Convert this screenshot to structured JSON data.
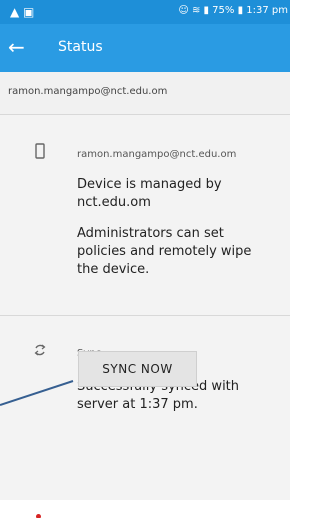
{
  "statusbar": {
    "left": "▲ ▣",
    "right": "☺ ≋ ▮ 75% ▮ 1:37 pm"
  },
  "toolbar": {
    "title": "Status",
    "back_icon": "arrow-left"
  },
  "account": {
    "header_email": "ramon.mangampo@nct.edu.om"
  },
  "device": {
    "email": "ramon.mangampo@nct.edu.om",
    "managed_text": "Device is managed by nct.edu.om",
    "admin_text": "Administrators can set policies and remotely wipe the device."
  },
  "sync": {
    "label": "Sync",
    "status_text": "Successfully synced with server at 1:37 pm.",
    "button_label": "SYNC NOW"
  },
  "colors": {
    "statusbar": "#1e8fd8",
    "toolbar": "#2a9be3",
    "background": "#f1f1f1"
  }
}
